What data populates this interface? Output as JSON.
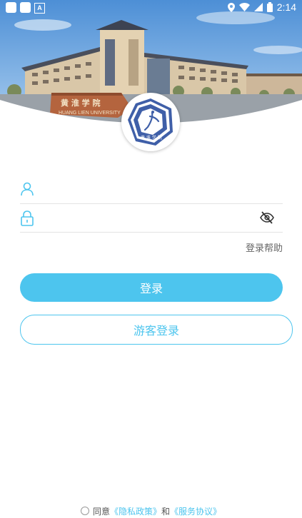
{
  "status_bar": {
    "time": "2:14"
  },
  "header": {
    "school_sign_text": "HUANG LIEN UNIVERSITY"
  },
  "login": {
    "username_placeholder": "",
    "password_placeholder": "",
    "help_label": "登录帮助",
    "login_button": "登录",
    "guest_button": "游客登录"
  },
  "agreement": {
    "prefix": "同意",
    "privacy_link": "《隐私政策》",
    "and": "和",
    "service_link": "《服务协议》"
  },
  "colors": {
    "accent": "#4dc5ee",
    "text_muted": "#666666",
    "divider": "#e3e3e3"
  },
  "icons": [
    "user-icon",
    "lock-icon",
    "eye-off-icon",
    "university-logo"
  ]
}
